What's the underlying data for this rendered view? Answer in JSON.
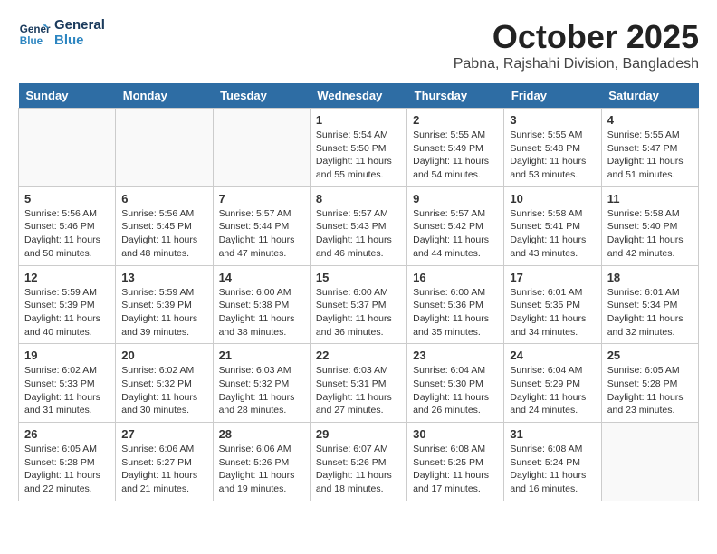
{
  "header": {
    "title": "October 2025",
    "location": "Pabna, Rajshahi Division, Bangladesh",
    "logo_line1": "General",
    "logo_line2": "Blue"
  },
  "days_of_week": [
    "Sunday",
    "Monday",
    "Tuesday",
    "Wednesday",
    "Thursday",
    "Friday",
    "Saturday"
  ],
  "weeks": [
    [
      {
        "day": "",
        "info": ""
      },
      {
        "day": "",
        "info": ""
      },
      {
        "day": "",
        "info": ""
      },
      {
        "day": "1",
        "info": "Sunrise: 5:54 AM\nSunset: 5:50 PM\nDaylight: 11 hours\nand 55 minutes."
      },
      {
        "day": "2",
        "info": "Sunrise: 5:55 AM\nSunset: 5:49 PM\nDaylight: 11 hours\nand 54 minutes."
      },
      {
        "day": "3",
        "info": "Sunrise: 5:55 AM\nSunset: 5:48 PM\nDaylight: 11 hours\nand 53 minutes."
      },
      {
        "day": "4",
        "info": "Sunrise: 5:55 AM\nSunset: 5:47 PM\nDaylight: 11 hours\nand 51 minutes."
      }
    ],
    [
      {
        "day": "5",
        "info": "Sunrise: 5:56 AM\nSunset: 5:46 PM\nDaylight: 11 hours\nand 50 minutes."
      },
      {
        "day": "6",
        "info": "Sunrise: 5:56 AM\nSunset: 5:45 PM\nDaylight: 11 hours\nand 48 minutes."
      },
      {
        "day": "7",
        "info": "Sunrise: 5:57 AM\nSunset: 5:44 PM\nDaylight: 11 hours\nand 47 minutes."
      },
      {
        "day": "8",
        "info": "Sunrise: 5:57 AM\nSunset: 5:43 PM\nDaylight: 11 hours\nand 46 minutes."
      },
      {
        "day": "9",
        "info": "Sunrise: 5:57 AM\nSunset: 5:42 PM\nDaylight: 11 hours\nand 44 minutes."
      },
      {
        "day": "10",
        "info": "Sunrise: 5:58 AM\nSunset: 5:41 PM\nDaylight: 11 hours\nand 43 minutes."
      },
      {
        "day": "11",
        "info": "Sunrise: 5:58 AM\nSunset: 5:40 PM\nDaylight: 11 hours\nand 42 minutes."
      }
    ],
    [
      {
        "day": "12",
        "info": "Sunrise: 5:59 AM\nSunset: 5:39 PM\nDaylight: 11 hours\nand 40 minutes."
      },
      {
        "day": "13",
        "info": "Sunrise: 5:59 AM\nSunset: 5:39 PM\nDaylight: 11 hours\nand 39 minutes."
      },
      {
        "day": "14",
        "info": "Sunrise: 6:00 AM\nSunset: 5:38 PM\nDaylight: 11 hours\nand 38 minutes."
      },
      {
        "day": "15",
        "info": "Sunrise: 6:00 AM\nSunset: 5:37 PM\nDaylight: 11 hours\nand 36 minutes."
      },
      {
        "day": "16",
        "info": "Sunrise: 6:00 AM\nSunset: 5:36 PM\nDaylight: 11 hours\nand 35 minutes."
      },
      {
        "day": "17",
        "info": "Sunrise: 6:01 AM\nSunset: 5:35 PM\nDaylight: 11 hours\nand 34 minutes."
      },
      {
        "day": "18",
        "info": "Sunrise: 6:01 AM\nSunset: 5:34 PM\nDaylight: 11 hours\nand 32 minutes."
      }
    ],
    [
      {
        "day": "19",
        "info": "Sunrise: 6:02 AM\nSunset: 5:33 PM\nDaylight: 11 hours\nand 31 minutes."
      },
      {
        "day": "20",
        "info": "Sunrise: 6:02 AM\nSunset: 5:32 PM\nDaylight: 11 hours\nand 30 minutes."
      },
      {
        "day": "21",
        "info": "Sunrise: 6:03 AM\nSunset: 5:32 PM\nDaylight: 11 hours\nand 28 minutes."
      },
      {
        "day": "22",
        "info": "Sunrise: 6:03 AM\nSunset: 5:31 PM\nDaylight: 11 hours\nand 27 minutes."
      },
      {
        "day": "23",
        "info": "Sunrise: 6:04 AM\nSunset: 5:30 PM\nDaylight: 11 hours\nand 26 minutes."
      },
      {
        "day": "24",
        "info": "Sunrise: 6:04 AM\nSunset: 5:29 PM\nDaylight: 11 hours\nand 24 minutes."
      },
      {
        "day": "25",
        "info": "Sunrise: 6:05 AM\nSunset: 5:28 PM\nDaylight: 11 hours\nand 23 minutes."
      }
    ],
    [
      {
        "day": "26",
        "info": "Sunrise: 6:05 AM\nSunset: 5:28 PM\nDaylight: 11 hours\nand 22 minutes."
      },
      {
        "day": "27",
        "info": "Sunrise: 6:06 AM\nSunset: 5:27 PM\nDaylight: 11 hours\nand 21 minutes."
      },
      {
        "day": "28",
        "info": "Sunrise: 6:06 AM\nSunset: 5:26 PM\nDaylight: 11 hours\nand 19 minutes."
      },
      {
        "day": "29",
        "info": "Sunrise: 6:07 AM\nSunset: 5:26 PM\nDaylight: 11 hours\nand 18 minutes."
      },
      {
        "day": "30",
        "info": "Sunrise: 6:08 AM\nSunset: 5:25 PM\nDaylight: 11 hours\nand 17 minutes."
      },
      {
        "day": "31",
        "info": "Sunrise: 6:08 AM\nSunset: 5:24 PM\nDaylight: 11 hours\nand 16 minutes."
      },
      {
        "day": "",
        "info": ""
      }
    ]
  ],
  "colors": {
    "header_bg": "#2e6da4",
    "header_text": "#ffffff",
    "border": "#cccccc"
  }
}
